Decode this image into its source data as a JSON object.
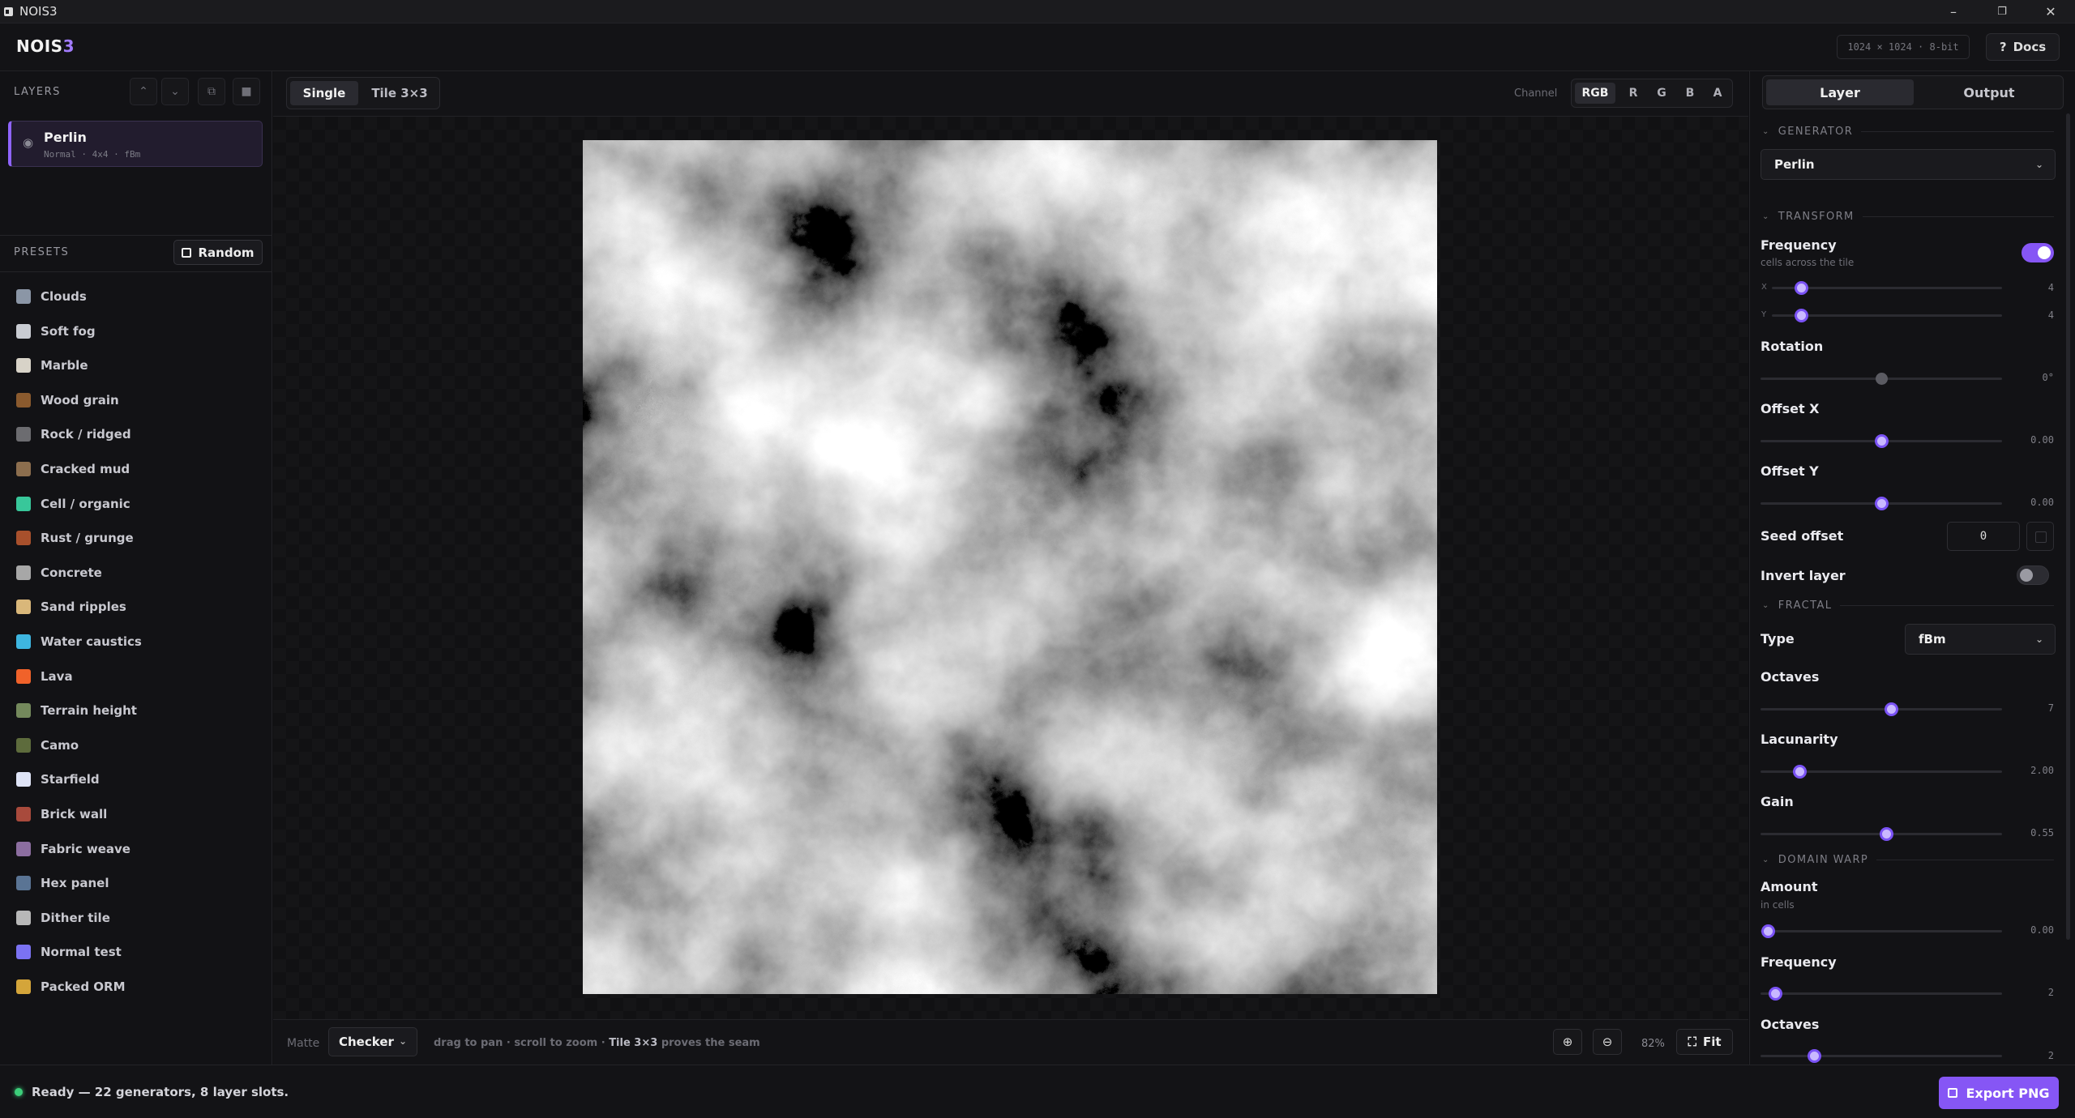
{
  "window": {
    "title": "NOIS3",
    "minimize": "–",
    "restore": "❐",
    "close": "✕"
  },
  "header": {
    "logo_main": "NOIS",
    "logo_accent": "3",
    "size_chip": "1024 × 1024 · 8-bit",
    "docs_icon": "?",
    "docs_label": "Docs"
  },
  "layers": {
    "title": "LAYERS",
    "buttons": [
      {
        "name": "move-up",
        "icon": "chevron-up-icon",
        "glyph": "⌃"
      },
      {
        "name": "move-down",
        "icon": "chevron-down-icon",
        "glyph": "⌄"
      },
      {
        "name": "duplicate",
        "icon": "copy-icon",
        "glyph": "⧉"
      },
      {
        "name": "delete",
        "icon": "trash-icon",
        "glyph": "■"
      }
    ],
    "items": [
      {
        "name": "Perlin",
        "meta": "Normal · 4x4 · fBm",
        "visible": true
      }
    ]
  },
  "presets": {
    "title": "PRESETS",
    "random_label": "Random",
    "items": [
      {
        "label": "Clouds",
        "color": "#8b96a6"
      },
      {
        "label": "Soft fog",
        "color": "#c9ccd2"
      },
      {
        "label": "Marble",
        "color": "#d8d3c8"
      },
      {
        "label": "Wood grain",
        "color": "#8a5a2e"
      },
      {
        "label": "Rock / ridged",
        "color": "#6c6c70"
      },
      {
        "label": "Cracked mud",
        "color": "#8c6e4e"
      },
      {
        "label": "Cell / organic",
        "color": "#38c79a"
      },
      {
        "label": "Rust / grunge",
        "color": "#a8502c"
      },
      {
        "label": "Concrete",
        "color": "#a7a7a7"
      },
      {
        "label": "Sand ripples",
        "color": "#d9b77a"
      },
      {
        "label": "Water caustics",
        "color": "#3eb6e0"
      },
      {
        "label": "Lava",
        "color": "#f0622a"
      },
      {
        "label": "Terrain height",
        "color": "#74895c"
      },
      {
        "label": "Camo",
        "color": "#5d6b3c"
      },
      {
        "label": "Starfield",
        "color": "#dfe4f7"
      },
      {
        "label": "Brick wall",
        "color": "#a84a3c"
      },
      {
        "label": "Fabric weave",
        "color": "#8c6ea0"
      },
      {
        "label": "Hex panel",
        "color": "#5a7494"
      },
      {
        "label": "Dither tile",
        "color": "#b8b8b8"
      },
      {
        "label": "Normal test",
        "color": "#7b72f2"
      },
      {
        "label": "Packed ORM",
        "color": "#d4a53a"
      }
    ]
  },
  "viewer": {
    "view_tabs": [
      {
        "label": "Single",
        "active": true
      },
      {
        "label": "Tile 3×3",
        "active": false
      }
    ],
    "channel_label": "Channel",
    "channels": [
      {
        "label": "RGB",
        "active": true
      },
      {
        "label": "R",
        "active": false
      },
      {
        "label": "G",
        "active": false
      },
      {
        "label": "B",
        "active": false
      },
      {
        "label": "A",
        "active": false
      }
    ],
    "matte_label": "Matte",
    "matte_value": "Checker",
    "hint_start": "drag to pan · scroll to zoom · ",
    "hint_bold": "Tile 3×3",
    "hint_end": " proves the seam",
    "zoom_in_icon": "zoom-in-icon",
    "zoom_out_icon": "zoom-out-icon",
    "zoom_level": "82%",
    "fit_label": "Fit"
  },
  "inspector": {
    "tabs": [
      {
        "label": "Layer",
        "active": true
      },
      {
        "label": "Output",
        "active": false
      }
    ],
    "generator": {
      "title": "GENERATOR",
      "value": "Perlin"
    },
    "transform": {
      "title": "TRANSFORM",
      "frequency": {
        "label": "Frequency",
        "sub": "cells across the tile",
        "linked": true,
        "x": {
          "axis": "X",
          "value": "4",
          "fraction": 0.125
        },
        "y": {
          "axis": "Y",
          "value": "4",
          "fraction": 0.125
        }
      },
      "rotation": {
        "label": "Rotation",
        "value": "0°",
        "fraction": 0.5
      },
      "offset_x": {
        "label": "Offset X",
        "value": "0.00",
        "fraction": 0.5
      },
      "offset_y": {
        "label": "Offset Y",
        "value": "0.00",
        "fraction": 0.5
      },
      "seed_offset": {
        "label": "Seed offset",
        "value": "0"
      },
      "invert": {
        "label": "Invert layer",
        "on": false
      }
    },
    "fractal": {
      "title": "FRACTAL",
      "type": {
        "label": "Type",
        "value": "fBm"
      },
      "octaves": {
        "label": "Octaves",
        "value": "7",
        "fraction": 0.54
      },
      "lacunarity": {
        "label": "Lacunarity",
        "value": "2.00",
        "fraction": 0.16
      },
      "gain": {
        "label": "Gain",
        "value": "0.55",
        "fraction": 0.52
      }
    },
    "domain_warp": {
      "title": "DOMAIN WARP",
      "amount": {
        "label": "Amount",
        "sub": "in cells",
        "value": "0.00",
        "fraction": 0.03
      },
      "frequency": {
        "label": "Frequency",
        "value": "2",
        "fraction": 0.06
      },
      "octaves": {
        "label": "Octaves",
        "value": "2",
        "fraction": 0.22
      }
    }
  },
  "status": {
    "text": "Ready — 22 generators, 8 layer slots.",
    "export_label": "Export PNG"
  },
  "colors": {
    "accent": "#8656f5",
    "status_ok": "#3ccf7a"
  }
}
